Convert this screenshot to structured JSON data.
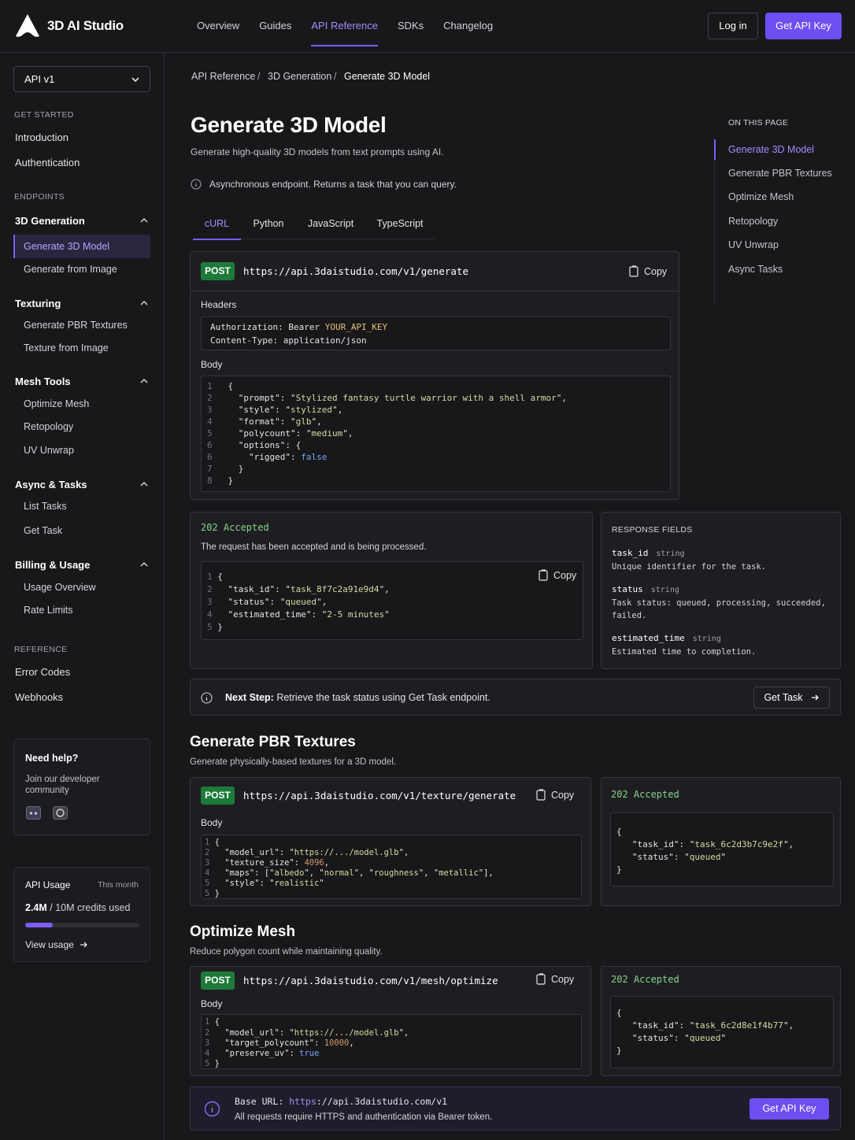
{
  "header": {
    "brand": "3D AI Studio",
    "nav": [
      "Overview",
      "Guides",
      "API Reference",
      "SDKs",
      "Changelog"
    ],
    "active_nav": "API Reference",
    "login_label": "Log in",
    "api_key_label": "Get API Key"
  },
  "sidebar": {
    "version": "API v1",
    "get_started_heading": "GET STARTED",
    "get_started": [
      "Introduction",
      "Authentication"
    ],
    "endpoints_heading": "ENDPOINTS",
    "groups": [
      {
        "label": "3D Generation",
        "items": [
          "Generate 3D Model",
          "Generate from Image"
        ]
      },
      {
        "label": "Texturing",
        "items": [
          "Generate PBR Textures",
          "Texture from Image"
        ]
      },
      {
        "label": "Mesh Tools",
        "items": [
          "Optimize Mesh",
          "Retopology",
          "UV Unwrap"
        ]
      },
      {
        "label": "Async & Tasks",
        "items": [
          "List Tasks",
          "Get Task"
        ]
      },
      {
        "label": "Billing & Usage",
        "items": [
          "Usage Overview",
          "Rate Limits"
        ]
      }
    ],
    "reference_heading": "REFERENCE",
    "reference": [
      "Error Codes",
      "Webhooks"
    ],
    "help": {
      "title": "Need help?",
      "text": "Join our developer community"
    },
    "usage": {
      "title": "API Usage",
      "period": "This month",
      "used": "2.4M",
      "total": "/ 10M credits used",
      "fraction": 0.24,
      "link": "View usage"
    }
  },
  "breadcrumb": [
    "API Reference",
    "3D Generation",
    "Generate 3D Model"
  ],
  "page": {
    "title": "Generate 3D Model",
    "subtitle": "Generate high-quality 3D models from text prompts using AI.",
    "note": "Asynchronous endpoint. Returns a task that you can query.",
    "tabs": [
      "cURL",
      "Python",
      "JavaScript",
      "TypeScript"
    ],
    "active_tab": "cURL"
  },
  "request": {
    "method": "POST",
    "url": "https://api.3daistudio.com/v1/generate",
    "copy": "Copy",
    "headers_label": "Headers",
    "auth_prefix": "Authorization: Bearer ",
    "auth_value": "YOUR_API_KEY",
    "content_type": "Content-Type: application/json",
    "body_label": "Body",
    "prompt": "Stylized fantasy turtle warrior with a shell armor",
    "style": "stylized",
    "format": "glb",
    "polycount": "medium",
    "rigged": "false"
  },
  "response": {
    "status": "202 Accepted",
    "message": "The request has been accepted and is being processed.",
    "task_id": "task_8f7c2a91e9d4",
    "task_status": "queued",
    "estimated_time": "2-5 minutes",
    "copy": "Copy"
  },
  "response_fields": {
    "title": "RESPONSE FIELDS",
    "fields": [
      {
        "name": "task_id",
        "type": "string",
        "desc": "Unique identifier for the task."
      },
      {
        "name": "status",
        "type": "string",
        "desc": "Task status: queued, processing, succeeded, failed."
      },
      {
        "name": "estimated_time",
        "type": "string",
        "desc": "Estimated time to completion."
      }
    ]
  },
  "next_step": {
    "label": "Next Step:",
    "text": "Retrieve the task status using Get Task endpoint.",
    "button": "Get Task"
  },
  "pbr": {
    "title": "Generate PBR Textures",
    "subtitle": "Generate physically-based textures for a 3D model.",
    "method": "POST",
    "url": "https://api.3daistudio.com/v1/texture/generate",
    "copy": "Copy",
    "body_label": "Body",
    "model_url": "https://.../model.glb",
    "texture_size": "4096",
    "maps": [
      "albedo",
      "normal",
      "roughness",
      "metallic"
    ],
    "style": "realistic",
    "status": "202 Accepted",
    "task_id": "task_6c2d3b7c9e2f",
    "task_status": "queued"
  },
  "optimize": {
    "title": "Optimize Mesh",
    "subtitle": "Reduce polygon count while maintaining quality.",
    "method": "POST",
    "url": "https://api.3daistudio.com/v1/mesh/optimize",
    "copy": "Copy",
    "body_label": "Body",
    "model_url": "https://.../model.glb",
    "target_polycount": "10000",
    "preserve_uv": "true",
    "status": "202 Accepted",
    "task_id": "task_6c2d8e1f4b77",
    "task_status": "queued"
  },
  "base": {
    "label": "Base URL:",
    "scheme": "https",
    "rest": "://api.3daistudio.com/v1",
    "note": "All requests require HTTPS and authentication via Bearer token.",
    "button": "Get API Key"
  },
  "toc": {
    "title": "ON THIS PAGE",
    "items": [
      "Generate 3D Model",
      "Generate PBR Textures",
      "Optimize Mesh",
      "Retopology",
      "UV Unwrap",
      "Async Tasks"
    ],
    "active": "Generate 3D Model"
  },
  "colors": {
    "accent": "#7c5cf5",
    "post": "#1e7a3a",
    "background": "#18181b"
  }
}
